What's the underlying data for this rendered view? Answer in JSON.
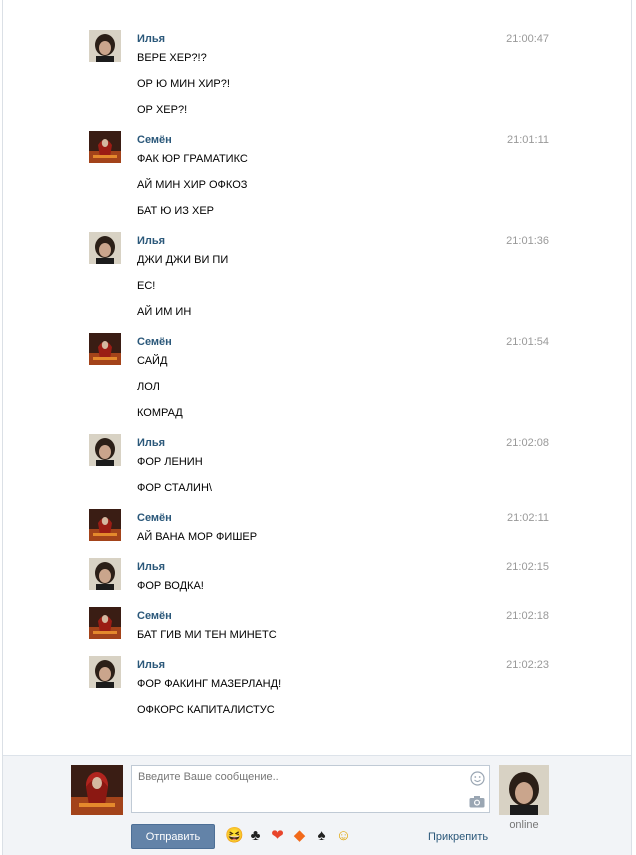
{
  "messages": [
    {
      "author": "Илья",
      "avatar": "ilya",
      "time": "21:00:47",
      "lines": [
        "ВЕРЕ ХЕР?!?",
        "ОР Ю МИН ХИР?!",
        "ОР ХЕР?!"
      ]
    },
    {
      "author": "Семён",
      "avatar": "semyon",
      "time": "21:01:11",
      "lines": [
        "ФАК ЮР ГРАМАТИКС",
        "АЙ МИН ХИР ОФКОЗ",
        "БАТ Ю ИЗ ХЕР"
      ]
    },
    {
      "author": "Илья",
      "avatar": "ilya",
      "time": "21:01:36",
      "lines": [
        "ДЖИ ДЖИ ВИ ПИ",
        "ЕС!",
        "АЙ ИМ ИН"
      ]
    },
    {
      "author": "Семён",
      "avatar": "semyon",
      "time": "21:01:54",
      "lines": [
        "САЙД",
        "ЛОЛ",
        "КОМРАД"
      ]
    },
    {
      "author": "Илья",
      "avatar": "ilya",
      "time": "21:02:08",
      "lines": [
        "ФОР ЛЕНИН",
        "ФОР СТАЛИН\\"
      ]
    },
    {
      "author": "Семён",
      "avatar": "semyon",
      "time": "21:02:11",
      "lines": [
        "АЙ ВАНА МОР ФИШЕР"
      ]
    },
    {
      "author": "Илья",
      "avatar": "ilya",
      "time": "21:02:15",
      "lines": [
        "ФОР ВОДКА!"
      ]
    },
    {
      "author": "Семён",
      "avatar": "semyon",
      "time": "21:02:18",
      "lines": [
        "БАТ ГИВ МИ ТЕН МИНЕТС"
      ]
    },
    {
      "author": "Илья",
      "avatar": "ilya",
      "time": "21:02:23",
      "lines": [
        "ФОР ФАКИНГ МАЗЕРЛАНД!",
        "ОФКОРС КАПИТАЛИСТУС"
      ]
    }
  ],
  "compose": {
    "placeholder": "Введите Ваше сообщение..",
    "send_label": "Отправить",
    "attach_label": "Прикрепить",
    "peer_status": "online",
    "emoji": [
      {
        "name": "laughing-emoji-icon",
        "glyph": "😆",
        "color": "#e0a400"
      },
      {
        "name": "club-emoji-icon",
        "glyph": "♣",
        "color": "#222222"
      },
      {
        "name": "heart-emoji-icon",
        "glyph": "❤",
        "color": "#e8452c"
      },
      {
        "name": "diamond-emoji-icon",
        "glyph": "◆",
        "color": "#f26a1b"
      },
      {
        "name": "spade-emoji-icon",
        "glyph": "♠",
        "color": "#222222"
      },
      {
        "name": "blush-emoji-icon",
        "glyph": "☺",
        "color": "#e0a400"
      }
    ]
  },
  "colors": {
    "author": "#2b587a",
    "time": "#999999",
    "send_button": "#6383a8",
    "compose_bg": "#f2f4f7"
  }
}
